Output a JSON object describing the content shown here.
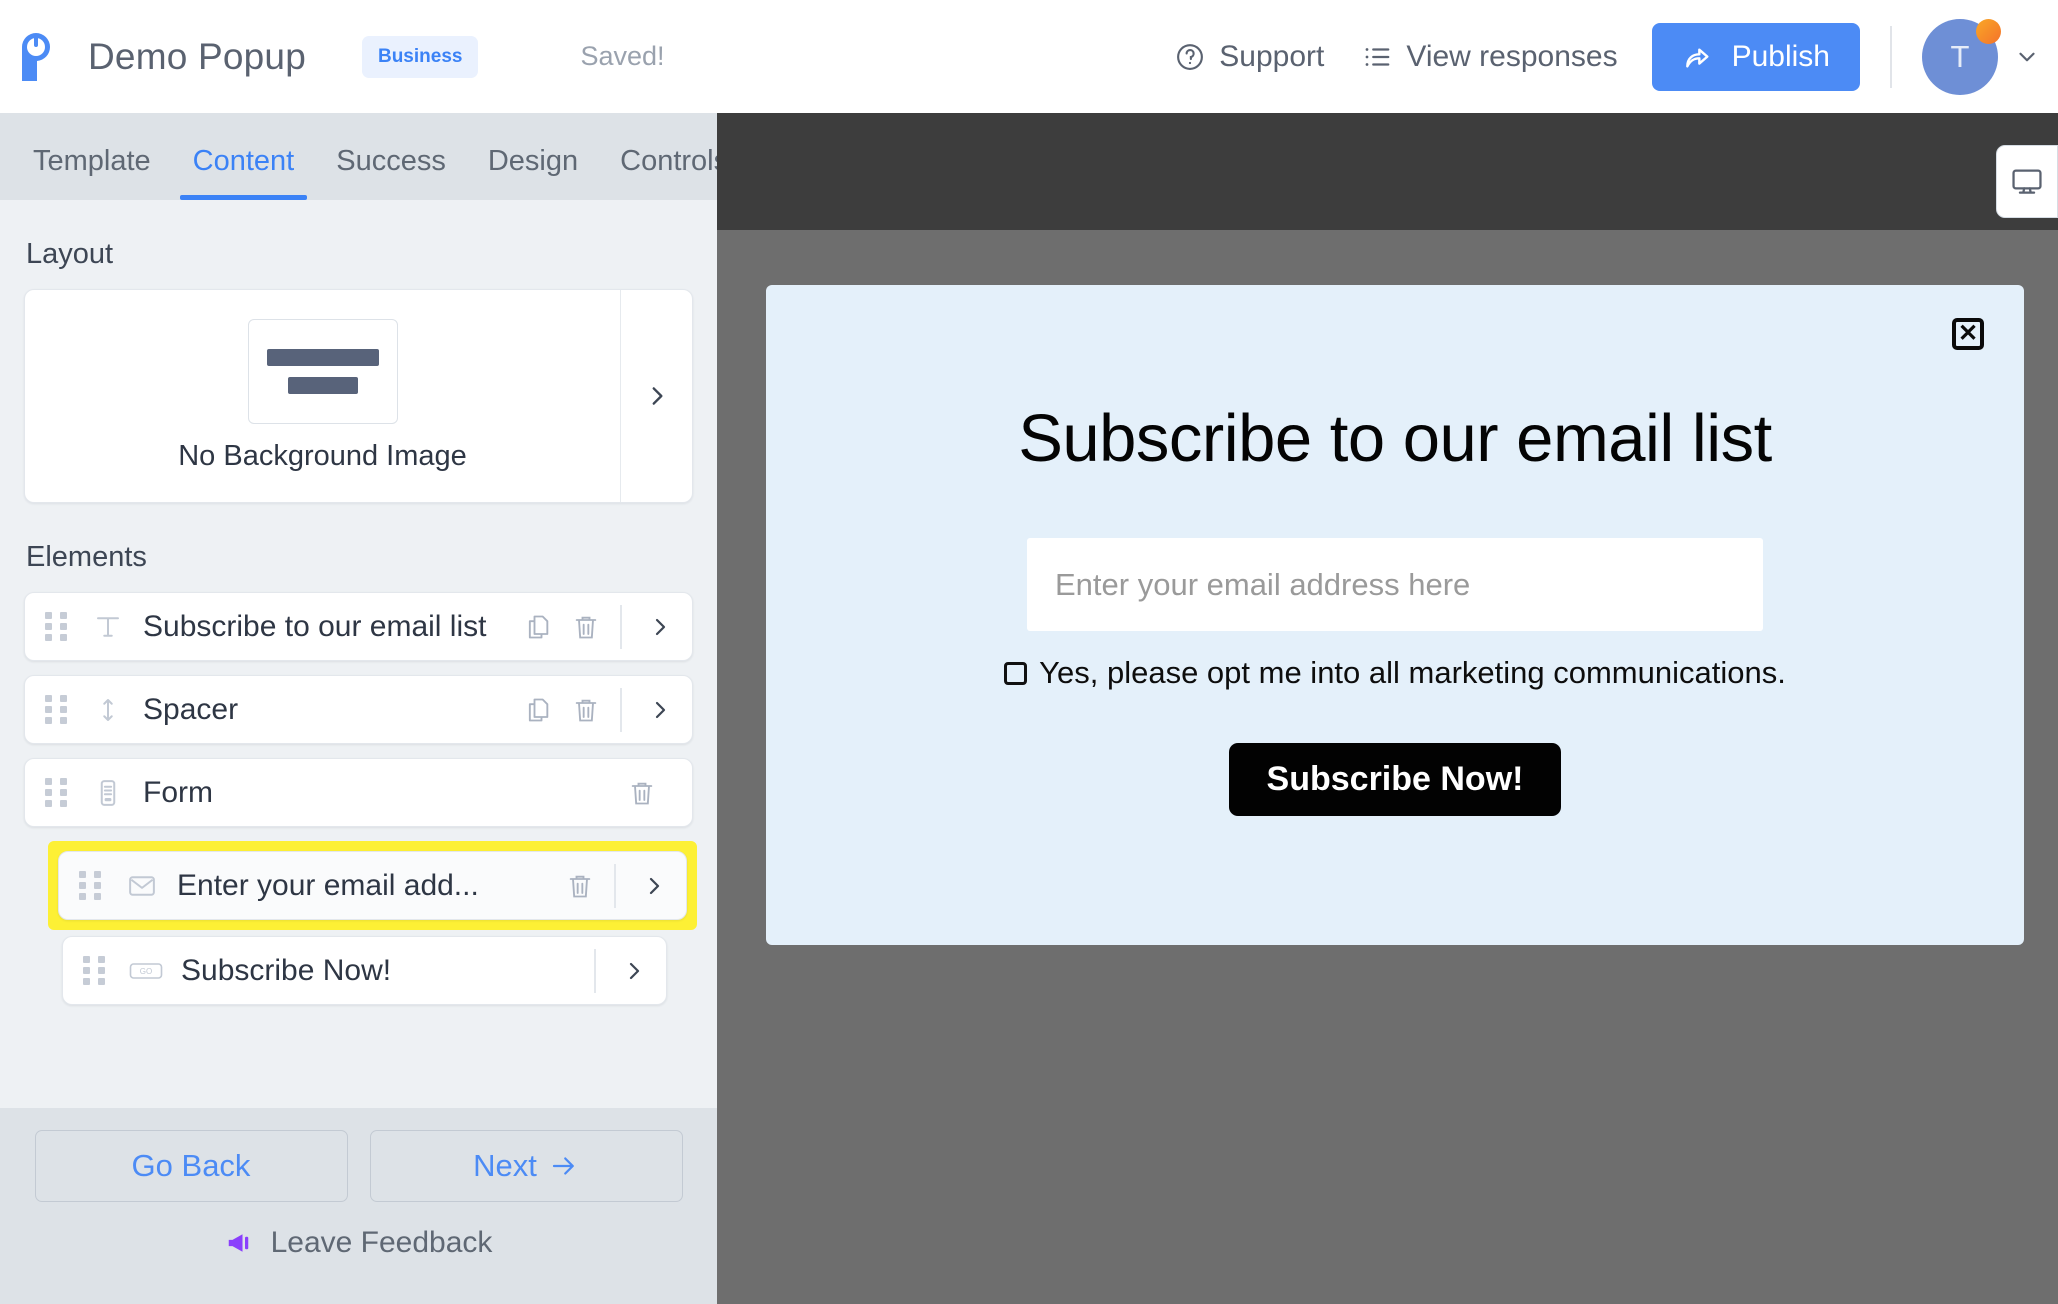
{
  "header": {
    "logo_icon": "pabbly-power-logo-icon",
    "title": "Demo Popup",
    "plan_badge": "Business",
    "save_status": "Saved!",
    "support_label": "Support",
    "support_icon": "question-circle-icon",
    "responses_label": "View responses",
    "responses_icon": "list-icon",
    "publish_label": "Publish",
    "publish_icon": "share-arrow-icon",
    "publish_color": "#4c8bf5",
    "avatar_initial": "T",
    "avatar_color": "#6e8fd6",
    "avatar_badge_color": "#f4a02b",
    "caret_icon": "chevron-down-icon"
  },
  "tabs": [
    {
      "label": "Template",
      "active": false
    },
    {
      "label": "Content",
      "active": true
    },
    {
      "label": "Success",
      "active": false
    },
    {
      "label": "Design",
      "active": false
    },
    {
      "label": "Controls",
      "active": false
    }
  ],
  "layout": {
    "section_label": "Layout",
    "caption": "No Background Image",
    "chevron_icon": "chevron-right-icon"
  },
  "elements": {
    "section_label": "Elements",
    "items": [
      {
        "label": "Subscribe to our email list",
        "icon": "text-type-icon",
        "has_copy": true,
        "has_delete": true,
        "has_chevron": true,
        "nested": false,
        "highlighted": false
      },
      {
        "label": "Spacer",
        "icon": "vertical-resize-icon",
        "has_copy": true,
        "has_delete": true,
        "has_chevron": true,
        "nested": false,
        "highlighted": false
      },
      {
        "label": "Form",
        "icon": "form-icon",
        "has_copy": false,
        "has_delete": true,
        "has_chevron": false,
        "nested": false,
        "highlighted": false
      },
      {
        "label": "Enter your email add...",
        "icon": "envelope-icon",
        "has_copy": false,
        "has_delete": true,
        "has_chevron": true,
        "nested": true,
        "highlighted": true
      },
      {
        "label": "Subscribe Now!",
        "icon": "go-button-icon",
        "has_copy": false,
        "has_delete": false,
        "has_chevron": true,
        "nested": true,
        "highlighted": false
      }
    ],
    "highlight_color": "#fdf035"
  },
  "footer": {
    "go_back_label": "Go Back",
    "next_label": "Next",
    "next_icon": "arrow-right-icon",
    "feedback_label": "Leave Feedback",
    "feedback_icon": "megaphone-icon",
    "feedback_icon_color": "#8a3ffc"
  },
  "preview": {
    "device_icon": "desktop-monitor-icon",
    "background_color": "#6e6e6e",
    "top_bar_color": "#3d3d3d",
    "popup": {
      "background_color": "#e4f0fa",
      "close_icon": "close-x-icon",
      "title": "Subscribe to our email list",
      "email_placeholder": "Enter your email address here",
      "email_value": "",
      "optin_label": "Yes, please opt me into all marketing communications.",
      "optin_checked": false,
      "cta_label": "Subscribe Now!",
      "cta_color": "#020202"
    }
  }
}
